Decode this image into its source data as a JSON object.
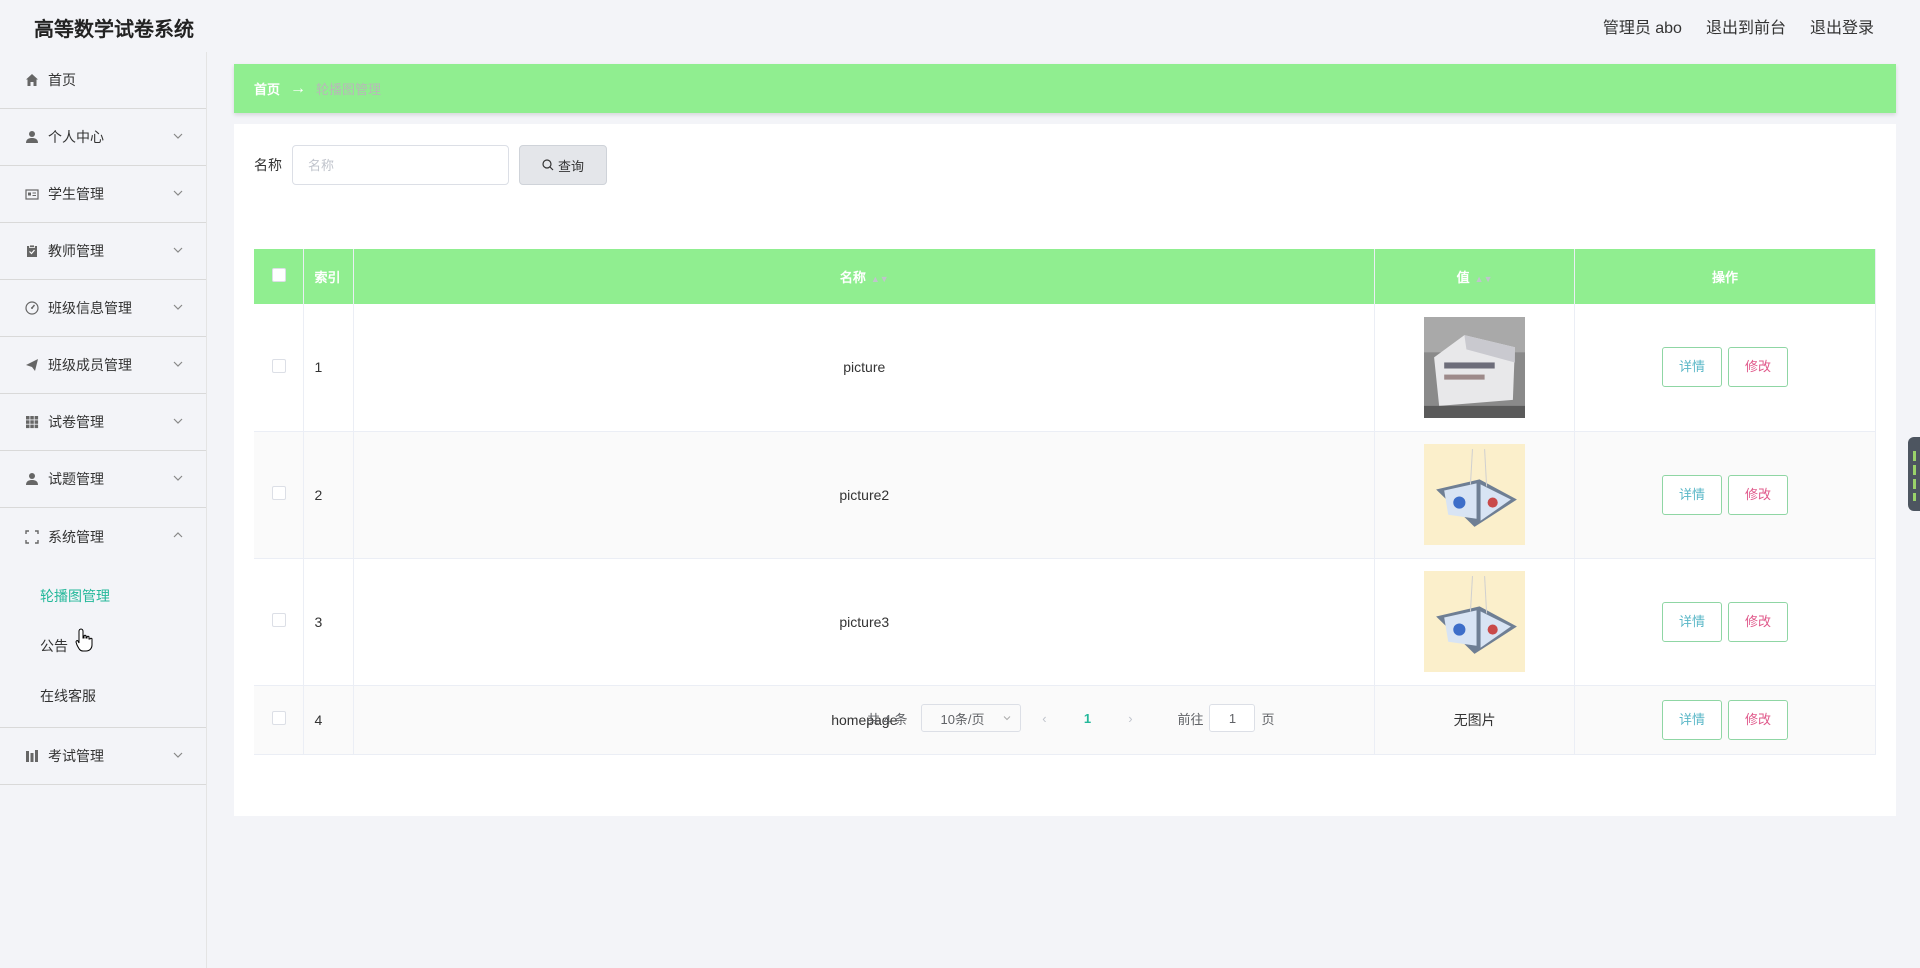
{
  "app": {
    "title": "高等数学试卷系统"
  },
  "header": {
    "admin_label": "管理员 abo",
    "front_link": "退出到前台",
    "logout_link": "退出登录"
  },
  "sidebar": {
    "items": [
      {
        "label": "首页",
        "icon": "home-icon"
      },
      {
        "label": "个人中心",
        "icon": "user-icon"
      },
      {
        "label": "学生管理",
        "icon": "id-card-icon"
      },
      {
        "label": "教师管理",
        "icon": "clipboard-icon"
      },
      {
        "label": "班级信息管理",
        "icon": "dashboard-icon"
      },
      {
        "label": "班级成员管理",
        "icon": "send-icon"
      },
      {
        "label": "试卷管理",
        "icon": "grid-icon"
      },
      {
        "label": "试题管理",
        "icon": "user-icon"
      },
      {
        "label": "系统管理",
        "icon": "fullscreen-icon"
      },
      {
        "label": "考试管理",
        "icon": "bar-chart-icon"
      }
    ],
    "system_sub": [
      {
        "label": "轮播图管理",
        "active": true
      },
      {
        "label": "公告",
        "active": false
      },
      {
        "label": "在线客服",
        "active": false
      }
    ]
  },
  "breadcrumb": {
    "home": "首页",
    "arrow": "→",
    "current": "轮播图管理"
  },
  "search": {
    "label": "名称",
    "placeholder": "名称",
    "button": "查询"
  },
  "table": {
    "headers": {
      "index": "索引",
      "name": "名称",
      "value": "值",
      "actions": "操作"
    },
    "rows": [
      {
        "index": "1",
        "name": "picture",
        "value_image": "building-photo",
        "value_text": ""
      },
      {
        "index": "2",
        "name": "picture2",
        "value_image": "book-photo",
        "value_text": ""
      },
      {
        "index": "3",
        "name": "picture3",
        "value_image": "book-photo",
        "value_text": ""
      },
      {
        "index": "4",
        "name": "homepage",
        "value_image": "",
        "value_text": "无图片"
      }
    ],
    "detail_label": "详情",
    "edit_label": "修改"
  },
  "pagination": {
    "total": "共 4 条",
    "page_size": "10条/页",
    "current_page": "1",
    "goto_label": "前往",
    "goto_value": "1",
    "page_suffix": "页"
  },
  "colors": {
    "accent": "#90ee90",
    "active_text": "#24b89a",
    "edit_text": "#e0588a",
    "detail_text": "#5ab7c7"
  }
}
